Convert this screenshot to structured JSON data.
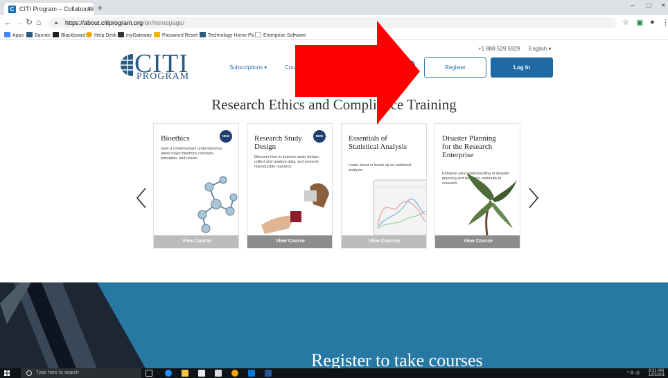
{
  "browser": {
    "tab_title": "CITI Program – Collaborative Ins",
    "tab_favicon": "C",
    "tab_close": "×",
    "new_tab": "+",
    "window_controls": [
      "–",
      "□",
      "×"
    ],
    "url_domain": "https://about.citiprogram.org",
    "url_path": "/en/homepage/",
    "bookmarks": [
      {
        "label": "Apps",
        "color": "#4285f4"
      },
      {
        "label": "Banner",
        "color": "#2a5b84"
      },
      {
        "label": "Blackboard",
        "color": "#222222"
      },
      {
        "label": "Help Desk",
        "color": "#f4a300"
      },
      {
        "label": "myGateway",
        "color": "#333333"
      },
      {
        "label": "Password Reset",
        "color": "#f4b400"
      },
      {
        "label": "Technology Home Pa",
        "color": "#2a5b84"
      },
      {
        "label": "Enterprise Software",
        "color": "#999999"
      }
    ]
  },
  "header": {
    "logo_main": "CITI",
    "logo_sub": "PROGRAM",
    "phone": "+1 888.529.5929",
    "language": "English ▾",
    "nav": [
      {
        "label": "Subscriptions ▾"
      },
      {
        "label": "Cou"
      }
    ],
    "register_label": "Register",
    "login_label": "Log In"
  },
  "main": {
    "headline": "Research Ethics and Compliance Training",
    "cards": [
      {
        "title": "Bioethics",
        "badge": "NEW",
        "description": "Gain a contemporary understanding about major bioethics concepts, principles, and issues.",
        "cta": "View Course"
      },
      {
        "title": "Research Study Design",
        "badge": "NEW",
        "description": "Discover how to improve study design, collect and analyze data, and promote reproducible research.",
        "cta": "View Course"
      },
      {
        "title": "Essentials of Statistical Analysis",
        "badge": "",
        "description": "Learn about or brush up on statistical analysis.",
        "cta": "View Courses"
      },
      {
        "title": "Disaster Planning for the Research Enterprise",
        "badge": "",
        "description": "Enhance your understanding of disaster planning and business continuity in research.",
        "cta": "View Course"
      }
    ],
    "banner_heading": "Register to take courses"
  },
  "taskbar": {
    "search_placeholder": "Type here to search",
    "time": "8:21 AM",
    "date": "12/5/201"
  },
  "colors": {
    "brand_blue": "#2a5b84",
    "button_blue": "#1f6aa5",
    "banner_blue": "#2778a3",
    "overlay_red": "#ff0000"
  }
}
